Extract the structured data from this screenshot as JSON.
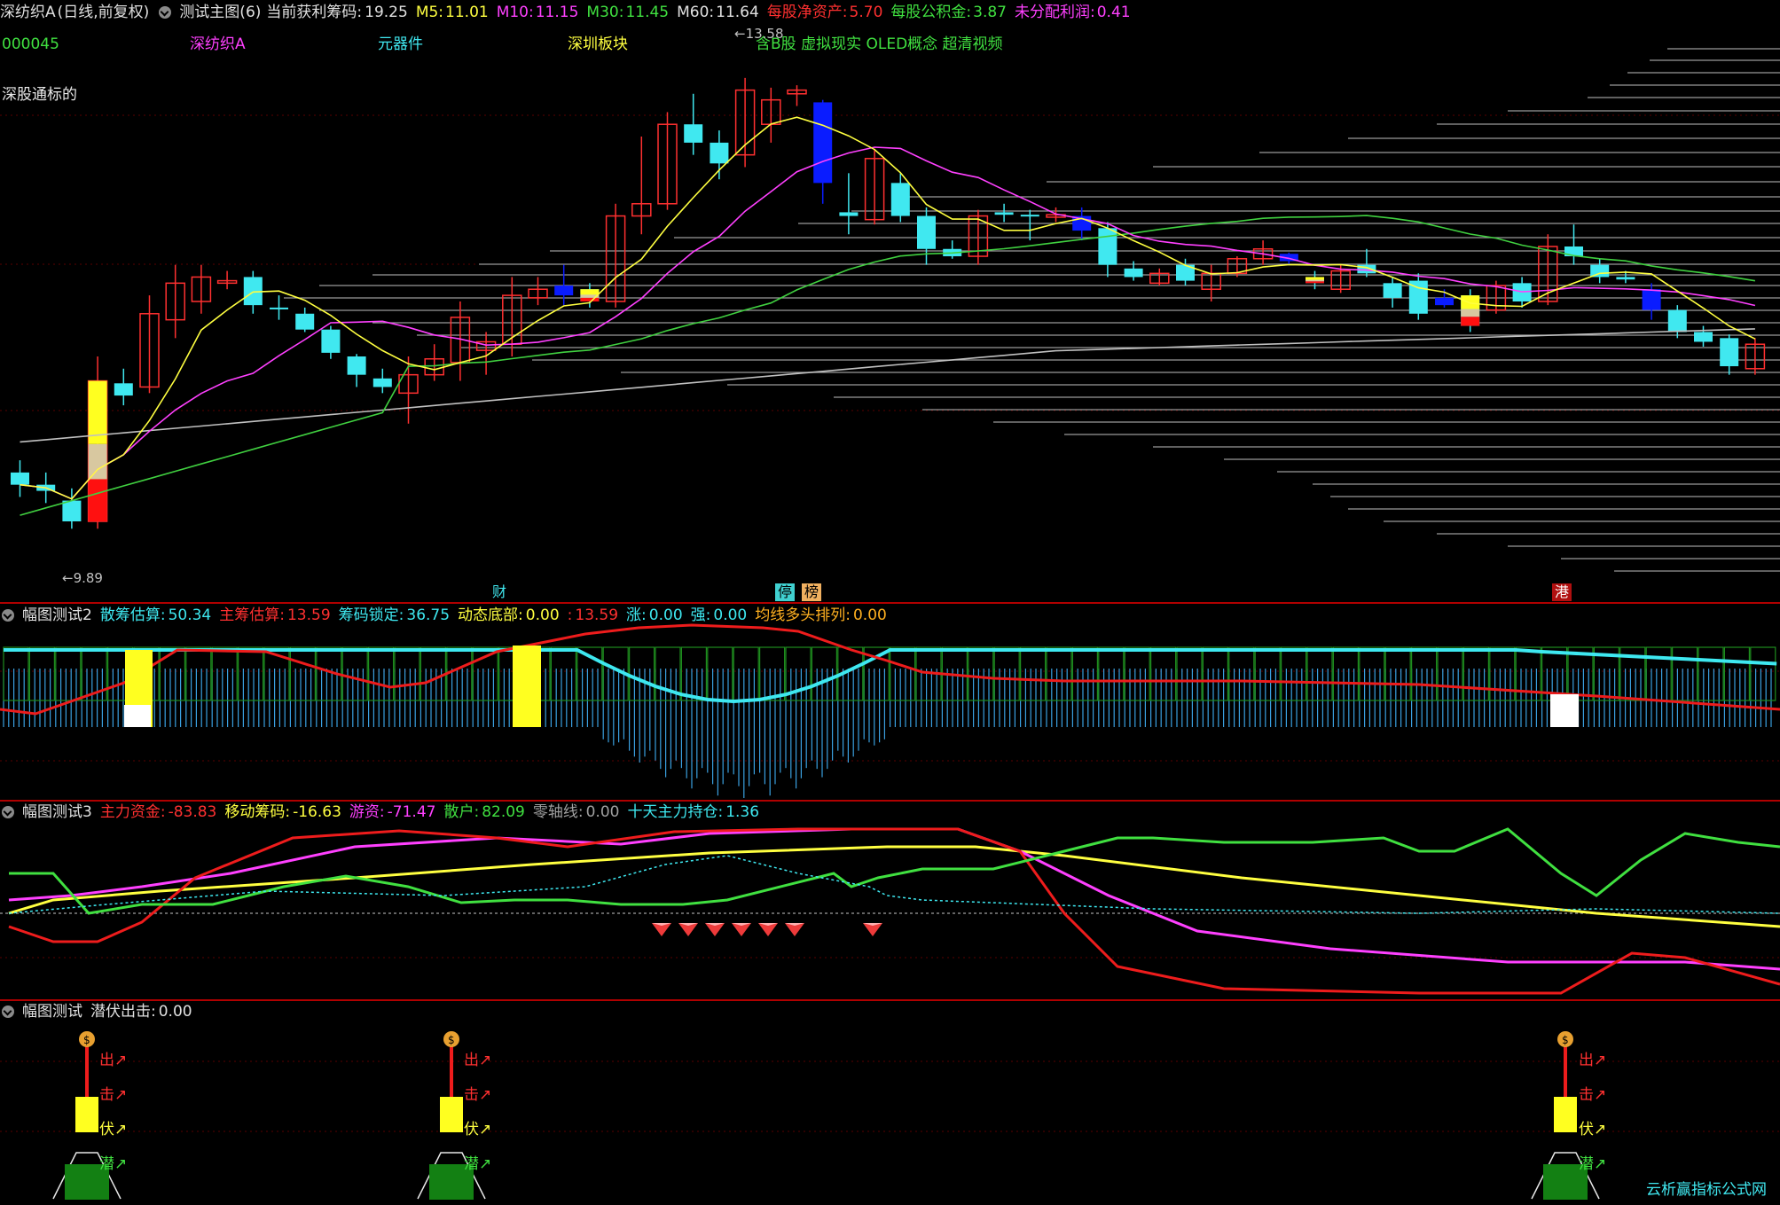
{
  "main_header": {
    "stock_name": "深纺织A",
    "period": "(日线,前复权)",
    "indicator": "测试主图(6)",
    "profit_chip_label": "当前获利筹码:",
    "profit_chip_value": "19.25",
    "ma5_label": "M5:",
    "ma5_value": "11.01",
    "ma10_label": "M10:",
    "ma10_value": "11.15",
    "ma30_label": "M30:",
    "ma30_value": "11.45",
    "ma60_label": "M60:",
    "ma60_value": "11.64",
    "net_asset_label": "每股净资产:",
    "net_asset_value": "5.70",
    "reserve_label": "每股公积金:",
    "reserve_value": "3.87",
    "undistributed_label": "未分配利润:",
    "undistributed_value": "0.41"
  },
  "info_row": {
    "code": "000045",
    "name": "深纺织A",
    "industry": "元器件",
    "board": "深圳板块",
    "concepts": "含B股 虚拟现实 OLED概念 超清视频"
  },
  "hk_connect": "深股通标的",
  "price_marks": {
    "high": "←13.58",
    "low": "←9.89"
  },
  "event_tags": {
    "cai": "财",
    "ting": "停",
    "bang": "榜",
    "gang": "港"
  },
  "panel2": {
    "title": "幅图测试2",
    "items": [
      {
        "label": "散筹估算:",
        "value": "50.34",
        "color": "#3ee8f0"
      },
      {
        "label": "主筹估算:",
        "value": "13.59",
        "color": "#ff3030"
      },
      {
        "label": "筹码锁定:",
        "value": "36.75",
        "color": "#3ee8f0"
      },
      {
        "label": "动态底部:",
        "value": "0.00",
        "color": "#ffff40"
      },
      {
        "label": ":",
        "value": "13.59",
        "color": "#ff3030"
      },
      {
        "label": "涨:",
        "value": "0.00",
        "color": "#3ee8f0"
      },
      {
        "label": "强:",
        "value": "0.00",
        "color": "#3ee8f0"
      },
      {
        "label": "均线多头排列:",
        "value": "0.00",
        "color": "#ffb020"
      }
    ]
  },
  "panel3": {
    "title": "幅图测试3",
    "items": [
      {
        "label": "主力资金:",
        "value": "-83.83",
        "color": "#ff3030"
      },
      {
        "label": "移动筹码:",
        "value": "-16.63",
        "color": "#ffff40"
      },
      {
        "label": "游资:",
        "value": "-71.47",
        "color": "#ff40ff"
      },
      {
        "label": "散户:",
        "value": "82.09",
        "color": "#40e040"
      },
      {
        "label": "零轴线:",
        "value": "0.00",
        "color": "#a0a0a0"
      },
      {
        "label": "十天主力持仓:",
        "value": "1.36",
        "color": "#3ee8f0"
      }
    ]
  },
  "panel4": {
    "title": "幅图测试",
    "label": "潜伏出击:",
    "value": "0.00",
    "stage_labels": [
      "出↗",
      "击↗",
      "伏↗",
      "潜↗"
    ],
    "money_icon": "money-bag-icon"
  },
  "watermark": "云析赢指标公式网",
  "colors": {
    "bg": "#000000",
    "up_candle": "#ff3030",
    "down_candle": "#40e8f0",
    "ma5": "#ffff40",
    "ma10": "#ff40ff",
    "ma30": "#40d040",
    "ma60": "#c0c0c0",
    "panel_border": "#b00000"
  },
  "chart_data": {
    "type": "candlestick",
    "ylim": [
      9.5,
      14.0
    ],
    "candles": [
      {
        "o": 10.35,
        "h": 10.45,
        "l": 10.15,
        "c": 10.25
      },
      {
        "o": 10.25,
        "h": 10.35,
        "l": 10.1,
        "c": 10.2
      },
      {
        "o": 10.12,
        "h": 10.22,
        "l": 9.89,
        "c": 9.95
      },
      {
        "o": 9.95,
        "h": 11.3,
        "l": 9.89,
        "c": 11.1
      },
      {
        "o": 11.08,
        "h": 11.2,
        "l": 10.9,
        "c": 10.98
      },
      {
        "o": 11.05,
        "h": 11.8,
        "l": 11.0,
        "c": 11.65
      },
      {
        "o": 11.6,
        "h": 12.05,
        "l": 11.45,
        "c": 11.9
      },
      {
        "o": 11.75,
        "h": 12.05,
        "l": 11.65,
        "c": 11.95
      },
      {
        "o": 11.9,
        "h": 12.0,
        "l": 11.85,
        "c": 11.92
      },
      {
        "o": 11.95,
        "h": 12.0,
        "l": 11.65,
        "c": 11.72
      },
      {
        "o": 11.7,
        "h": 11.8,
        "l": 11.6,
        "c": 11.69
      },
      {
        "o": 11.65,
        "h": 11.7,
        "l": 11.5,
        "c": 11.52
      },
      {
        "o": 11.52,
        "h": 11.55,
        "l": 11.28,
        "c": 11.33
      },
      {
        "o": 11.3,
        "h": 11.32,
        "l": 11.05,
        "c": 11.15
      },
      {
        "o": 11.12,
        "h": 11.2,
        "l": 11.0,
        "c": 11.05
      },
      {
        "o": 11.0,
        "h": 11.3,
        "l": 10.75,
        "c": 11.15
      },
      {
        "o": 11.15,
        "h": 11.4,
        "l": 11.1,
        "c": 11.28
      },
      {
        "o": 11.25,
        "h": 11.75,
        "l": 11.1,
        "c": 11.62
      },
      {
        "o": 11.35,
        "h": 11.5,
        "l": 11.15,
        "c": 11.42
      },
      {
        "o": 11.4,
        "h": 11.95,
        "l": 11.3,
        "c": 11.8
      },
      {
        "o": 11.78,
        "h": 11.95,
        "l": 11.72,
        "c": 11.85
      },
      {
        "o": 11.8,
        "h": 12.05,
        "l": 11.72,
        "c": 11.88
      },
      {
        "o": 11.85,
        "h": 11.9,
        "l": 11.7,
        "c": 11.75
      },
      {
        "o": 11.75,
        "h": 12.55,
        "l": 11.7,
        "c": 12.45
      },
      {
        "o": 12.45,
        "h": 13.1,
        "l": 12.3,
        "c": 12.55
      },
      {
        "o": 12.55,
        "h": 13.3,
        "l": 12.5,
        "c": 13.2
      },
      {
        "o": 13.2,
        "h": 13.45,
        "l": 12.95,
        "c": 13.05
      },
      {
        "o": 13.05,
        "h": 13.15,
        "l": 12.75,
        "c": 12.88
      },
      {
        "o": 12.95,
        "h": 13.58,
        "l": 12.85,
        "c": 13.48
      },
      {
        "o": 13.2,
        "h": 13.5,
        "l": 13.05,
        "c": 13.4
      },
      {
        "o": 13.45,
        "h": 13.52,
        "l": 13.35,
        "c": 13.48
      },
      {
        "o": 13.38,
        "h": 13.4,
        "l": 12.55,
        "c": 12.72
      },
      {
        "o": 12.48,
        "h": 12.8,
        "l": 12.3,
        "c": 12.45
      },
      {
        "o": 12.42,
        "h": 13.0,
        "l": 12.38,
        "c": 12.92
      },
      {
        "o": 12.72,
        "h": 12.8,
        "l": 12.4,
        "c": 12.45
      },
      {
        "o": 12.45,
        "h": 12.52,
        "l": 12.05,
        "c": 12.18
      },
      {
        "o": 12.18,
        "h": 12.25,
        "l": 12.1,
        "c": 12.12
      },
      {
        "o": 12.12,
        "h": 12.5,
        "l": 12.05,
        "c": 12.45
      },
      {
        "o": 12.48,
        "h": 12.55,
        "l": 12.4,
        "c": 12.46
      },
      {
        "o": 12.46,
        "h": 12.5,
        "l": 12.25,
        "c": 12.45
      },
      {
        "o": 12.44,
        "h": 12.52,
        "l": 12.4,
        "c": 12.46
      },
      {
        "o": 12.45,
        "h": 12.52,
        "l": 12.25,
        "c": 12.33
      },
      {
        "o": 12.35,
        "h": 12.4,
        "l": 11.95,
        "c": 12.05
      },
      {
        "o": 12.02,
        "h": 12.08,
        "l": 11.92,
        "c": 11.95
      },
      {
        "o": 11.9,
        "h": 12.02,
        "l": 11.88,
        "c": 11.98
      },
      {
        "o": 12.05,
        "h": 12.1,
        "l": 11.88,
        "c": 11.92
      },
      {
        "o": 11.85,
        "h": 12.05,
        "l": 11.75,
        "c": 11.98
      },
      {
        "o": 11.98,
        "h": 12.12,
        "l": 11.95,
        "c": 12.1
      },
      {
        "o": 12.1,
        "h": 12.25,
        "l": 12.05,
        "c": 12.18
      },
      {
        "o": 12.14,
        "h": 12.15,
        "l": 12.05,
        "c": 12.08
      },
      {
        "o": 11.95,
        "h": 12.0,
        "l": 11.85,
        "c": 11.9
      },
      {
        "o": 11.85,
        "h": 12.05,
        "l": 11.82,
        "c": 12.0
      },
      {
        "o": 12.05,
        "h": 12.18,
        "l": 11.95,
        "c": 11.98
      },
      {
        "o": 11.9,
        "h": 11.95,
        "l": 11.7,
        "c": 11.78
      },
      {
        "o": 11.92,
        "h": 11.98,
        "l": 11.6,
        "c": 11.65
      },
      {
        "o": 11.78,
        "h": 11.85,
        "l": 11.7,
        "c": 11.72
      },
      {
        "o": 11.8,
        "h": 11.85,
        "l": 11.5,
        "c": 11.55
      },
      {
        "o": 11.68,
        "h": 11.92,
        "l": 11.65,
        "c": 11.88
      },
      {
        "o": 11.9,
        "h": 11.95,
        "l": 11.7,
        "c": 11.75
      },
      {
        "o": 11.75,
        "h": 12.3,
        "l": 11.72,
        "c": 12.2
      },
      {
        "o": 12.2,
        "h": 12.38,
        "l": 12.05,
        "c": 12.12
      },
      {
        "o": 12.05,
        "h": 12.1,
        "l": 11.9,
        "c": 11.95
      },
      {
        "o": 11.95,
        "h": 12.0,
        "l": 11.9,
        "c": 11.93
      },
      {
        "o": 11.85,
        "h": 11.9,
        "l": 11.6,
        "c": 11.68
      },
      {
        "o": 11.68,
        "h": 11.72,
        "l": 11.45,
        "c": 11.5
      },
      {
        "o": 11.5,
        "h": 11.55,
        "l": 11.38,
        "c": 11.42
      },
      {
        "o": 11.45,
        "h": 11.48,
        "l": 11.15,
        "c": 11.22
      },
      {
        "o": 11.2,
        "h": 11.45,
        "l": 11.15,
        "c": 11.4
      }
    ]
  }
}
